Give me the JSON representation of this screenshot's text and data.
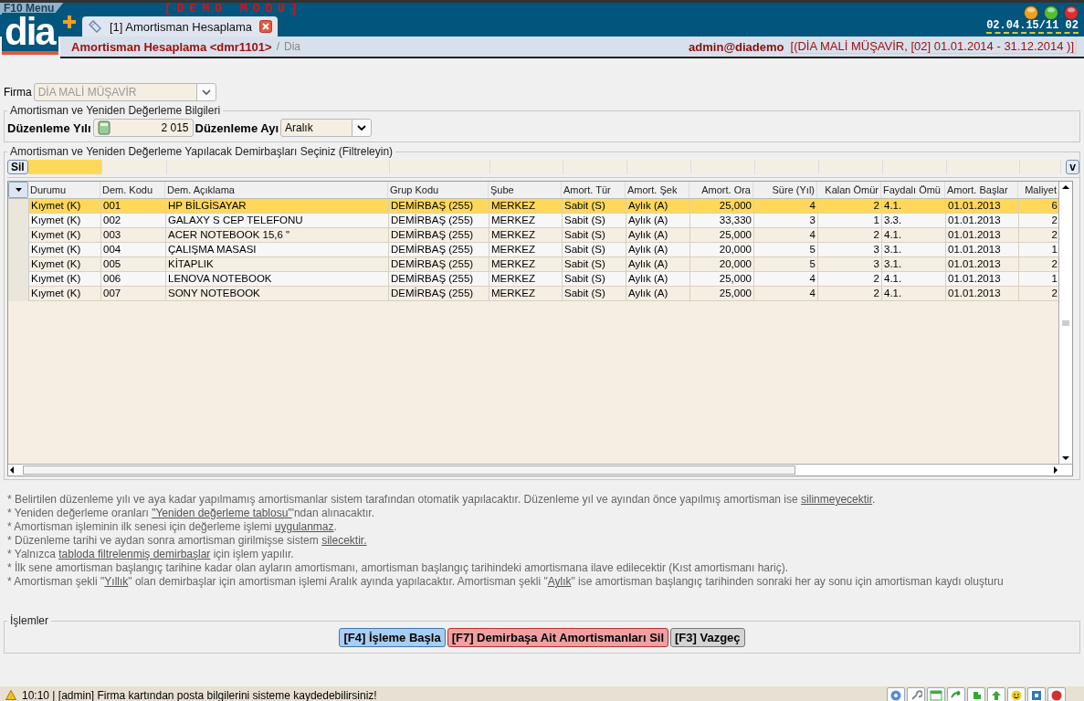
{
  "menu_label": "F10 Menu",
  "demo_banner": "[DEMO MODU]",
  "logo": "dia",
  "tab": {
    "label": "[1] Amortisman Hesaplama"
  },
  "clock": "02.04.15/11 02",
  "breadcrumb": {
    "title": "Amortisman Hesaplama <dmr1101>",
    "separator": "/",
    "module": "Dia"
  },
  "user": {
    "name": "admin@diademo",
    "context": "[(DİA MALİ MÜŞAVİR, [02] 01.01.2014 - 31.12.2014 )]"
  },
  "firm": {
    "label": "Firma",
    "value": "DİA MALİ MÜŞAVİR",
    "disabled": true
  },
  "period_group": {
    "title": "Amortisman ve Yeniden Değerleme Bilgileri",
    "year_label": "Düzenleme Yılı",
    "year_value": "2 015",
    "month_label": "Düzenleme Ayı",
    "month_value": "Aralık"
  },
  "asset_group": {
    "title": "Amortisman ve Yeniden Değerleme Yapılacak Demirbaşları Seçiniz (Filtreleyin)",
    "clear_button": "Sil",
    "columns_button": "v",
    "columns": [
      {
        "label": "Durumu",
        "kind": "text"
      },
      {
        "label": "Dem. Kodu",
        "kind": "text"
      },
      {
        "label": "Dem. Açıklama",
        "kind": "text"
      },
      {
        "label": "Grup Kodu",
        "kind": "text"
      },
      {
        "label": "Şube",
        "kind": "text"
      },
      {
        "label": "Amort. Tür",
        "kind": "text"
      },
      {
        "label": "Amort. Şek",
        "kind": "text"
      },
      {
        "label": "Amort. Ora",
        "kind": "number"
      },
      {
        "label": "Süre (Yıl)",
        "kind": "number"
      },
      {
        "label": "Kalan Ömür",
        "kind": "number"
      },
      {
        "label": "Faydalı Ömü",
        "kind": "text"
      },
      {
        "label": "Amort. Başlar",
        "kind": "text"
      },
      {
        "label": "Maliyet",
        "kind": "number"
      }
    ],
    "rows": [
      {
        "selected": true,
        "cells": [
          "Kıymet (K)",
          "001",
          "HP BİLGİSAYAR",
          "DEMİRBAŞ (255)",
          "MERKEZ",
          "Sabit (S)",
          "Aylık (A)",
          "25,000",
          "4",
          "2",
          "4.1.",
          "01.01.2013",
          "6"
        ]
      },
      {
        "selected": false,
        "cells": [
          "Kıymet (K)",
          "002",
          "GALAXY S CEP TELEFONU",
          "DEMİRBAŞ (255)",
          "MERKEZ",
          "Sabit (S)",
          "Aylık (A)",
          "33,330",
          "3",
          "1",
          "3.3.",
          "01.01.2013",
          "2"
        ]
      },
      {
        "selected": false,
        "cells": [
          "Kıymet (K)",
          "003",
          "ACER NOTEBOOK 15,6 \"",
          "DEMİRBAŞ (255)",
          "MERKEZ",
          "Sabit (S)",
          "Aylık (A)",
          "25,000",
          "4",
          "2",
          "4.1.",
          "01.01.2013",
          "2"
        ]
      },
      {
        "selected": false,
        "cells": [
          "Kıymet (K)",
          "004",
          "ÇALIŞMA MASASI",
          "DEMİRBAŞ (255)",
          "MERKEZ",
          "Sabit (S)",
          "Aylık (A)",
          "20,000",
          "5",
          "3",
          "3.1.",
          "01.01.2013",
          "1"
        ]
      },
      {
        "selected": false,
        "cells": [
          "Kıymet (K)",
          "005",
          "KİTAPLIK",
          "DEMİRBAŞ (255)",
          "MERKEZ",
          "Sabit (S)",
          "Aylık (A)",
          "20,000",
          "5",
          "3",
          "3.1.",
          "01.01.2013",
          "2"
        ]
      },
      {
        "selected": false,
        "cells": [
          "Kıymet (K)",
          "006",
          "LENOVA NOTEBOOK",
          "DEMİRBAŞ (255)",
          "MERKEZ",
          "Sabit (S)",
          "Aylık (A)",
          "25,000",
          "4",
          "2",
          "4.1.",
          "01.01.2013",
          "1"
        ]
      },
      {
        "selected": false,
        "cells": [
          "Kıymet (K)",
          "007",
          "SONY NOTEBOOK",
          "DEMİRBAŞ (255)",
          "MERKEZ",
          "Sabit (S)",
          "Aylık (A)",
          "25,000",
          "4",
          "2",
          "4.1.",
          "01.01.2013",
          "2"
        ]
      }
    ]
  },
  "notes": [
    [
      {
        "kind": "text",
        "text": "* Belirtilen düzenleme yılı ve aya kadar yapılmamış amortismanlar sistem tarafından otomatik yapılacaktır. Düzenleme yıl ve ayından önce yapılmış amortisman ise "
      },
      {
        "kind": "link",
        "text": "silinmeyecektir"
      },
      {
        "kind": "text",
        "text": "."
      }
    ],
    [
      {
        "kind": "text",
        "text": "* Yeniden değerleme oranları "
      },
      {
        "kind": "link",
        "text": "\"Yeniden değerleme tablosu\""
      },
      {
        "kind": "text",
        "text": "'ndan alınacaktır."
      }
    ],
    [
      {
        "kind": "text",
        "text": "* Amortisman işleminin ilk senesi için değerleme işlemi "
      },
      {
        "kind": "link",
        "text": "uygulanmaz"
      },
      {
        "kind": "text",
        "text": "."
      }
    ],
    [
      {
        "kind": "text",
        "text": "* Düzenleme tarihi ve aydan sonra amortisman girilmişse sistem "
      },
      {
        "kind": "link",
        "text": "silecektir."
      }
    ],
    [
      {
        "kind": "text",
        "text": "* Yalnızca "
      },
      {
        "kind": "link",
        "text": "tabloda filtrelenmiş demirbaşlar"
      },
      {
        "kind": "text",
        "text": " için işlem yapılır."
      }
    ],
    [
      {
        "kind": "text",
        "text": "* İlk sene amortisman başlangıç tarihine kadar olan ayların amortismanı, amortisman başlangıç tarihindeki amortismana ilave edilecektir (Kıst amortismanı hariç)."
      }
    ],
    [
      {
        "kind": "text",
        "text": "* Amortisman şekli \""
      },
      {
        "kind": "link",
        "text": "Yıllık"
      },
      {
        "kind": "text",
        "text": "\" olan demirbaşlar için amortisman işlemi Aralık ayında yapılacaktır. Amortisman şekli \""
      },
      {
        "kind": "link",
        "text": "Aylık"
      },
      {
        "kind": "text",
        "text": "\" ise amortisman başlangıç tarihinden sonraki her ay sonu için amortisman kaydı oluşturu"
      }
    ]
  ],
  "actions": {
    "title": "İşlemler",
    "buttons": [
      {
        "label": "[F4] İşleme Başla",
        "kind": "primary"
      },
      {
        "label": "[F7] Demirbaşa Ait Amortismanları Sil",
        "kind": "danger"
      },
      {
        "label": "[F3] Vazgeç",
        "kind": "neutral"
      }
    ]
  },
  "status_bar": {
    "message": "10:10 | [admin] Firma kartından posta bilgilerini sisteme kaydedebilirsiniz!"
  }
}
